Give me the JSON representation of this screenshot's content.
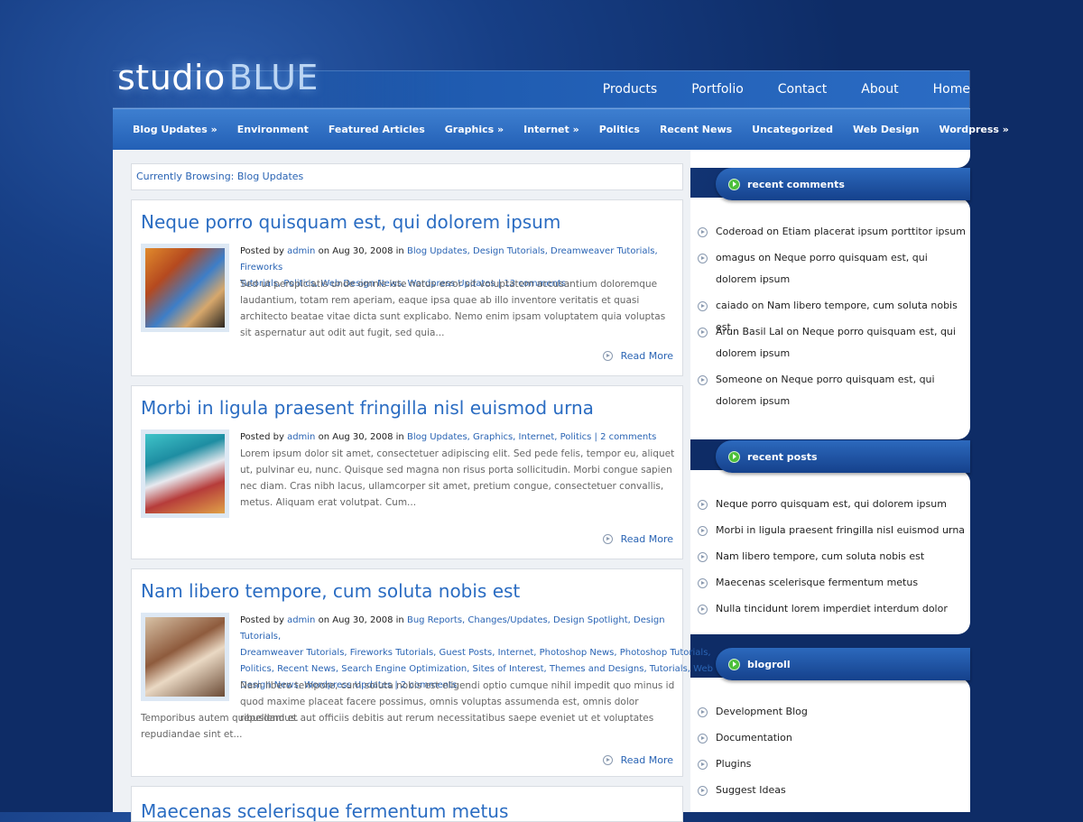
{
  "logo": {
    "part1": "studio",
    "part2": "BLUE"
  },
  "top_nav": [
    "Products",
    "Portfolio",
    "Contact",
    "About",
    "Home"
  ],
  "categories": [
    "Blog Updates »",
    "Environment",
    "Featured Articles",
    "Graphics »",
    "Internet »",
    "Politics",
    "Recent News",
    "Uncategorized",
    "Web Design",
    "Wordpress »"
  ],
  "breadcrumb": "Currently Browsing: Blog Updates",
  "posts": [
    {
      "title": "Neque porro quisquam est, qui dolorem ipsum",
      "posted_by": "Posted by",
      "author": "admin",
      "date": "on Aug 30, 2008 in",
      "meta_line1": "Blog Updates, Design Tutorials, Dreamweaver Tutorials, Fireworks",
      "meta_line2": "Tutorials, Politics, Web Design News, Wordpress Updates | 13 comments",
      "excerpt": "Sed ut perspiciatis unde omnis iste natus error sit voluptatem accusantium doloremque laudantium, totam rem aperiam, eaque ipsa quae ab illo inventore veritatis et quasi architecto beatae vitae dicta sunt explicabo. Nemo enim ipsam voluptatem quia voluptas sit aspernatur aut odit aut fugit, sed quia...",
      "read_more": "Read More"
    },
    {
      "title": "Morbi in ligula praesent fringilla nisl euismod urna",
      "posted_by": "Posted by",
      "author": "admin",
      "date": "on Aug 30, 2008 in",
      "meta_line1": "Blog Updates, Graphics, Internet, Politics | 2 comments",
      "excerpt": "Lorem ipsum dolor sit amet, consectetuer adipiscing elit. Sed pede felis, tempor eu, aliquet ut, pulvinar eu, nunc. Quisque sed magna non risus porta sollicitudin. Morbi congue sapien nec diam. Cras nibh lacus, ullamcorper sit amet, pretium congue, consectetuer convallis, metus. Aliquam erat volutpat. Cum...",
      "read_more": "Read More"
    },
    {
      "title": "Nam libero tempore, cum soluta nobis est",
      "posted_by": "Posted by",
      "author": "admin",
      "date": "on Aug 30, 2008 in",
      "meta_line1": "Bug Reports, Changes/Updates, Design Spotlight, Design Tutorials,",
      "meta_line2": "Dreamweaver Tutorials, Fireworks Tutorials, Guest Posts, Internet, Photoshop News, Photoshop Tutorials,",
      "meta_line3": "Politics, Recent News, Search Engine Optimization, Sites of Interest, Themes and Designs, Tutorials, Web",
      "meta_line4": "Design News, Wordpress Updates | 2 comments",
      "excerpt_a": "Nam libero tempore, cum soluta nobis est eligendi optio cumque nihil impedit quo minus id quod maxime placeat facere possimus, omnis voluptas assumenda est, omnis dolor repellendus.",
      "excerpt_b": "Temporibus autem quibusdam et aut officiis debitis aut rerum necessitatibus saepe eveniet ut et voluptates repudiandae sint et...",
      "read_more": "Read More"
    },
    {
      "title": "Maecenas scelerisque fermentum metus"
    }
  ],
  "sidebar": {
    "recent_comments": {
      "title": "recent comments",
      "items": [
        "Coderoad on Etiam placerat ipsum porttitor ipsum",
        "omagus on Neque porro quisquam est, qui dolorem ipsum",
        "caiado on Nam libero tempore, cum soluta nobis est",
        "Arun Basil Lal on Neque porro quisquam est, qui dolorem ipsum",
        "Someone on Neque porro quisquam est, qui dolorem ipsum"
      ]
    },
    "recent_posts": {
      "title": "recent posts",
      "items": [
        "Neque porro quisquam est, qui dolorem ipsum",
        "Morbi in ligula praesent fringilla nisl euismod urna",
        "Nam libero tempore, cum soluta nobis est",
        "Maecenas scelerisque fermentum metus",
        "Nulla tincidunt lorem imperdiet interdum dolor"
      ]
    },
    "blogroll": {
      "title": "blogroll",
      "items": [
        "Development Blog",
        "Documentation",
        "Plugins",
        "Suggest Ideas"
      ]
    }
  },
  "colors": {
    "accent": "#2a6cc2",
    "page_bg": "#0e2c66",
    "nav_bar": "#2360b6"
  }
}
